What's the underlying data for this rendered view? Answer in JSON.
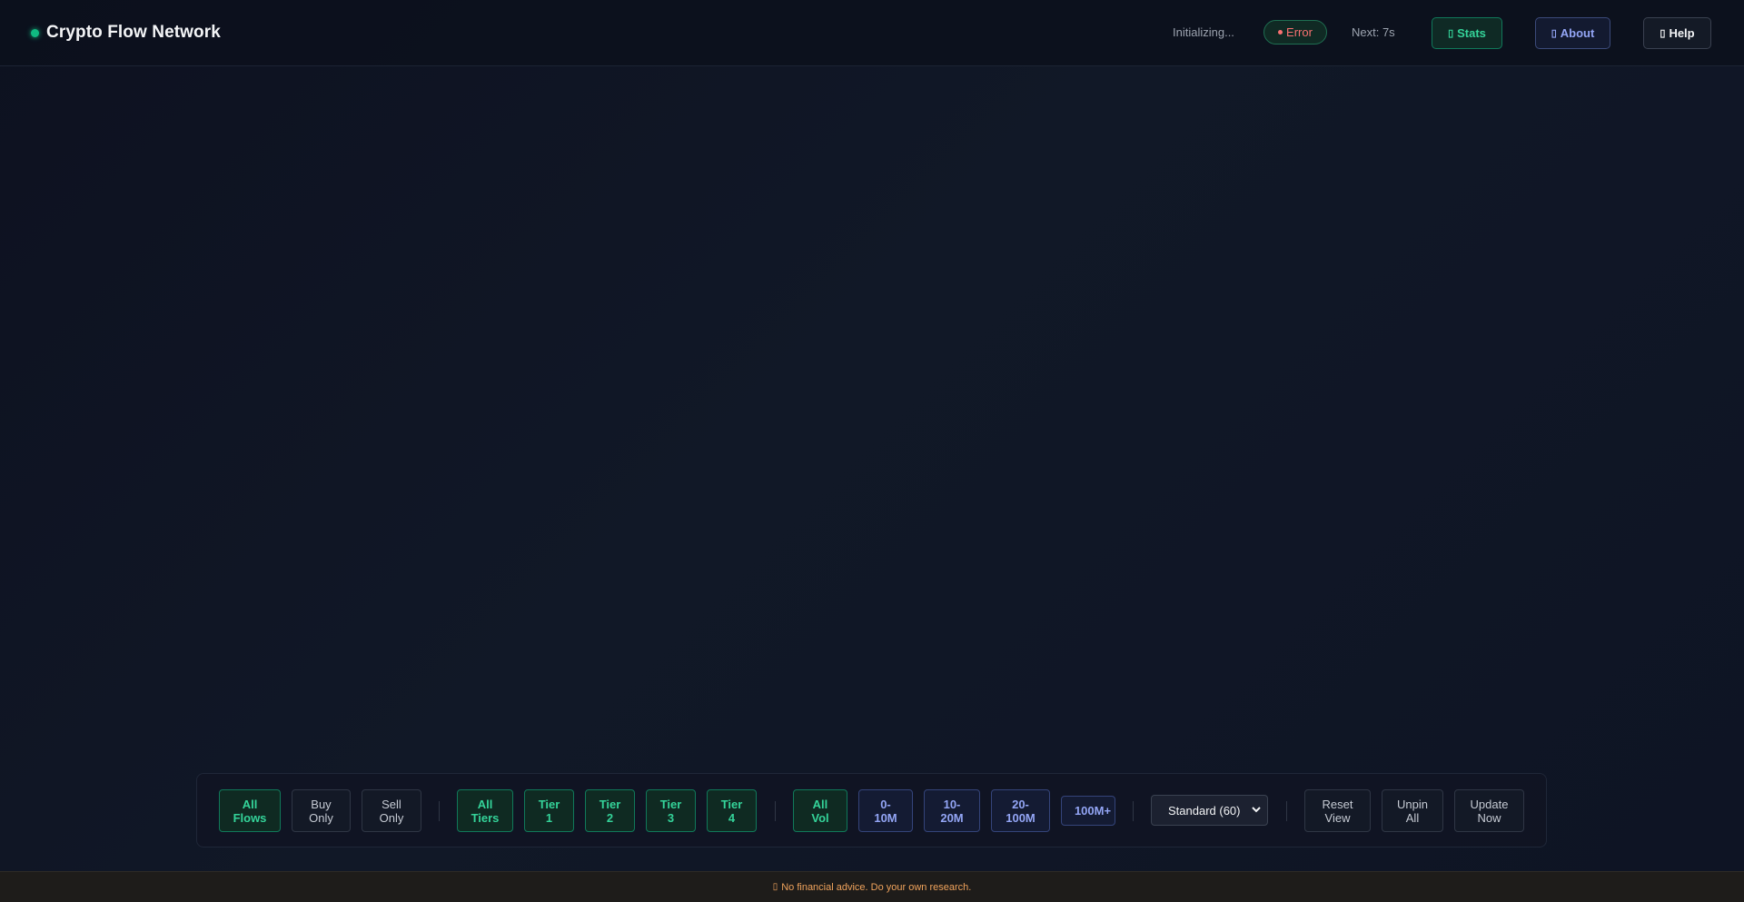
{
  "header": {
    "title": "Crypto Flow Network",
    "status_text": "Initializing...",
    "error_label": "Error",
    "next_label": "Next: 7s",
    "stats_label": "Stats",
    "about_label": "About",
    "help_label": "Help"
  },
  "filters": {
    "flow": [
      "All\nFlows",
      "Buy\nOnly",
      "Sell\nOnly"
    ],
    "tiers": [
      "All\nTiers",
      "Tier\n1",
      "Tier\n2",
      "Tier\n3",
      "Tier\n4"
    ],
    "volume": [
      "All\nVol",
      "0-\n10M",
      "10-\n20M",
      "20-\n100M",
      "100M+"
    ],
    "mode_select": "Standard (60)",
    "actions": [
      "Reset\nView",
      "Unpin\nAll",
      "Update\nNow"
    ]
  },
  "footer": {
    "disclaimer": "No financial advice. Do your own research."
  },
  "colors": {
    "accent_green": "#34d399",
    "accent_blue": "#93a5f5",
    "error_red": "#f87171",
    "warning_orange": "#f0a35c"
  },
  "icons": {
    "stats": "chart-icon",
    "about": "info-icon",
    "help": "question-icon",
    "footer": "warning-icon"
  }
}
